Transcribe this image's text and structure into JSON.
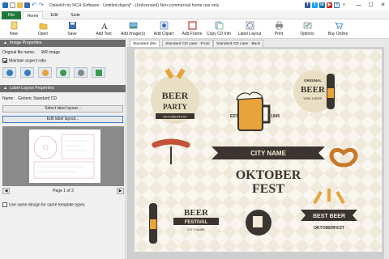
{
  "window": {
    "title": "Disketch by NCH Software - Untitled.dsproj* - (Unlicensed) Non-commercial home use only",
    "controls": [
      "—",
      "☐",
      "✕"
    ]
  },
  "menu_tabs": [
    "File",
    "Home",
    "Edit",
    "Suite"
  ],
  "ribbon": {
    "new": "New",
    "open": "Open",
    "save": "Save",
    "add_text": "Add Text",
    "add_images": "Add Image(s)",
    "add_clipart": "Add Clipart",
    "add_frame": "Add Frame",
    "copy_cd_info": "Copy CD Info",
    "label_layout": "Label Layout",
    "print": "Print",
    "options": "Options",
    "buy_online": "Buy Online"
  },
  "left_panel": {
    "image_properties": {
      "header": "Image Properties",
      "original_file_name_label": "Original file name:",
      "original_file_name_value": "WR image",
      "maintain_aspect_ratio": "Maintain aspect ratio",
      "maintain_aspect_ratio_checked": true
    },
    "label_layout_properties": {
      "header": "Label Layout Properties",
      "name_label": "Name:",
      "name_value": "Generic Standard CD",
      "select_label_layout": "Select label layout...",
      "edit_label_layout": "Edit label layout...",
      "page_indicator": "Page 1 of 3",
      "use_same_design": "Use same design for same template types",
      "use_same_design_checked": false
    }
  },
  "doc_tabs": [
    "Standard disc",
    "Standard CD case - Front",
    "Standard CD case - Back"
  ],
  "artwork": {
    "beer_party_title": "BEER",
    "beer_party_sub": "PARTY",
    "beer_party_ribbon": "OKTOBERFEST",
    "est": "EST",
    "year": "1945",
    "original": "ORIGINAL",
    "beer_right": "BEER",
    "beer_right_sub": "WINE & BEER",
    "city_name": "CITY NAME",
    "oktober": "OKTOBER",
    "fest": "FEST",
    "beer_festival_1": "BEER",
    "beer_festival_2": "FESTIVAL",
    "city_name_small": "CITY NAME",
    "best_beer": "BEST BEER",
    "oktoberfest_bottom": "OKTOBERFEST"
  },
  "colors": {
    "file_tab": "#1f7a3a",
    "section_header": "#6d6d6d",
    "art_dark": "#3a3530",
    "art_beer": "#e8a33a",
    "art_cream": "#f3ead8"
  }
}
